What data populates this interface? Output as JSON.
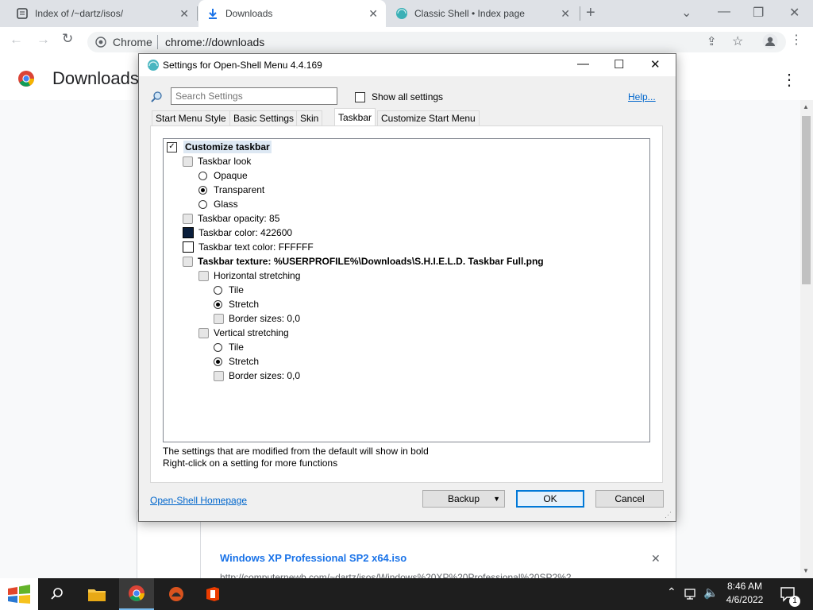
{
  "browser": {
    "tabs": [
      {
        "title": "Index of /~dartz/isos/",
        "active": false
      },
      {
        "title": "Downloads",
        "active": true
      },
      {
        "title": "Classic Shell • Index page",
        "active": false
      }
    ],
    "new_tab": "+",
    "omnibox": {
      "site": "Chrome",
      "url": "chrome://downloads"
    },
    "page_title": "Downloads"
  },
  "download_card": {
    "title": "Windows XP Professional SP2 x64.iso",
    "url": "http://computernewb.com/~dartz/isos/Windows%20XP%20Professional%20SP2%2..."
  },
  "dialog": {
    "title": "Settings for Open-Shell Menu 4.4.169",
    "search_placeholder": "Search Settings",
    "show_all": "Show all settings",
    "help": "Help...",
    "tabs": [
      "Start Menu Style",
      "Basic Settings",
      "Skin",
      "Taskbar",
      "Customize Start Menu"
    ],
    "selected_tab": "Taskbar",
    "tree": {
      "customize_taskbar": "Customize taskbar",
      "taskbar_look": "Taskbar look",
      "opaque": "Opaque",
      "transparent": "Transparent",
      "glass": "Glass",
      "opacity": "Taskbar opacity: 85",
      "color": "Taskbar color: 422600",
      "text_color": "Taskbar text color: FFFFFF",
      "texture": "Taskbar texture: %USERPROFILE%\\Downloads\\S.H.I.E.L.D. Taskbar Full.png",
      "h_stretch": "Horizontal stretching",
      "h_tile": "Tile",
      "h_stretch_opt": "Stretch",
      "h_border": "Border sizes: 0,0",
      "v_stretch": "Vertical stretching",
      "v_tile": "Tile",
      "v_stretch_opt": "Stretch",
      "v_border": "Border sizes: 0,0"
    },
    "hint1": "The settings that are modified from the default will show in bold",
    "hint2": "Right-click on a setting for more functions",
    "homepage": "Open-Shell Homepage",
    "backup": "Backup",
    "ok": "OK",
    "cancel": "Cancel"
  },
  "taskbar": {
    "time": "8:46 AM",
    "date": "4/6/2022",
    "notifications": "1"
  },
  "colors": {
    "taskbar_color_swatch": "#0a1e3c",
    "text_color_swatch": "#ffffff",
    "link": "#0066cc",
    "chrome_tabstrip": "#dee1e6"
  }
}
